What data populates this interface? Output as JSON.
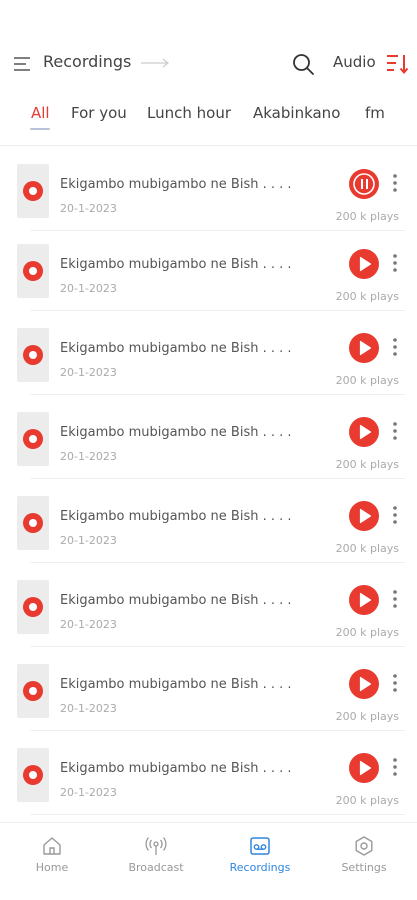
{
  "header": {
    "title": "Recordings",
    "menu_icon": "menu-icon",
    "arrow_icon": "arrow-right-icon",
    "search_icon": "search-icon",
    "audio_label": "Audio",
    "sort_icon": "sort-icon"
  },
  "tabs": [
    {
      "label": "All",
      "active": true
    },
    {
      "label": "For you",
      "active": false
    },
    {
      "label": "Lunch hour",
      "active": false
    },
    {
      "label": "Akabinkano",
      "active": false
    },
    {
      "label": "fm",
      "active": false
    }
  ],
  "recordings": [
    {
      "title": "Ekigambo mubigambo ne Bish . . . .",
      "date": "20-1-2023",
      "plays": "200 k plays",
      "state": "pause"
    },
    {
      "title": "Ekigambo mubigambo ne Bish . . . .",
      "date": "20-1-2023",
      "plays": "200 k plays",
      "state": "play"
    },
    {
      "title": "Ekigambo mubigambo ne Bish . . . .",
      "date": "20-1-2023",
      "plays": "200 k plays",
      "state": "play"
    },
    {
      "title": "Ekigambo mubigambo ne Bish . . . .",
      "date": "20-1-2023",
      "plays": "200 k plays",
      "state": "play"
    },
    {
      "title": "Ekigambo mubigambo ne Bish . . . .",
      "date": "20-1-2023",
      "plays": "200 k plays",
      "state": "play"
    },
    {
      "title": "Ekigambo mubigambo ne Bish . . . .",
      "date": "20-1-2023",
      "plays": "200 k plays",
      "state": "play"
    },
    {
      "title": "Ekigambo mubigambo ne Bish . . . .",
      "date": "20-1-2023",
      "plays": "200 k plays",
      "state": "play"
    },
    {
      "title": "Ekigambo mubigambo ne Bish . . . .",
      "date": "20-1-2023",
      "plays": "200 k plays",
      "state": "play"
    }
  ],
  "bottom_nav": [
    {
      "label": "Home",
      "icon": "home-icon",
      "active": false
    },
    {
      "label": "Broadcast",
      "icon": "broadcast-icon",
      "active": false
    },
    {
      "label": "Recordings",
      "icon": "recordings-icon",
      "active": true
    },
    {
      "label": "Settings",
      "icon": "settings-icon",
      "active": false
    }
  ],
  "colors": {
    "accent": "#e83a2f",
    "nav_active": "#2e86de",
    "text": "#444444",
    "muted": "#aaaaaa"
  }
}
